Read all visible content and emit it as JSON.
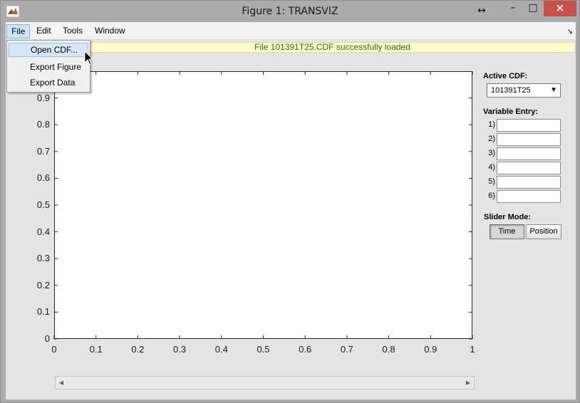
{
  "window": {
    "title": "Figure 1: TRANSVIZ",
    "restore_arrows": "↔",
    "minimize": "–",
    "maximize": "□",
    "close": "✕"
  },
  "menubar": {
    "items": [
      "File",
      "Edit",
      "Tools",
      "Window"
    ],
    "active_index": 0
  },
  "file_menu": {
    "items": [
      "Open CDF...",
      "Export Figure",
      "Export Data"
    ],
    "hover_index": 0
  },
  "status_message": "File 101391T25.CDF successfully loaded",
  "side_panel": {
    "active_cdf_label": "Active CDF:",
    "active_cdf_value": "101391T25",
    "variable_entry_label": "Variable Entry:",
    "variables": [
      {
        "label": "1)",
        "value": ""
      },
      {
        "label": "2)",
        "value": ""
      },
      {
        "label": "3)",
        "value": ""
      },
      {
        "label": "4)",
        "value": ""
      },
      {
        "label": "5)",
        "value": ""
      },
      {
        "label": "6)",
        "value": ""
      }
    ],
    "slider_mode_label": "Slider Mode:",
    "slider_mode_options": [
      "Time",
      "Position"
    ],
    "slider_mode_selected": "Time"
  },
  "scrollbar": {
    "left_arrow": "◀",
    "right_arrow": "▶",
    "value": 0
  },
  "colors": {
    "status_text": "#1a7a1a",
    "status_bg": "#ffffcc",
    "close_button": "#c7504c",
    "menu_active": "#cde4f7"
  },
  "chart_data": {
    "type": "line",
    "series": [],
    "xlim": [
      0,
      1
    ],
    "ylim": [
      0,
      1
    ],
    "xticks": [
      0,
      0.1,
      0.2,
      0.3,
      0.4,
      0.5,
      0.6,
      0.7,
      0.8,
      0.9,
      1
    ],
    "yticks": [
      0,
      0.1,
      0.2,
      0.3,
      0.4,
      0.5,
      0.6,
      0.7,
      0.8,
      0.9
    ],
    "xtick_labels": [
      "0",
      "0.1",
      "0.2",
      "0.3",
      "0.4",
      "0.5",
      "0.6",
      "0.7",
      "0.8",
      "0.9",
      "1"
    ],
    "ytick_labels": [
      "0",
      "0.1",
      "0.2",
      "0.3",
      "0.4",
      "0.5",
      "0.6",
      "0.7",
      "0.8",
      "0.9"
    ],
    "grid": false
  }
}
